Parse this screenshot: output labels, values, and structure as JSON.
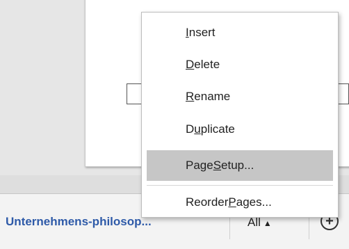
{
  "context_menu": {
    "items": [
      {
        "pre": "",
        "key": "I",
        "post": "nsert"
      },
      {
        "pre": "",
        "key": "D",
        "post": "elete"
      },
      {
        "pre": "",
        "key": "R",
        "post": "ename"
      },
      {
        "pre": "D",
        "key": "u",
        "post": "plicate"
      },
      {
        "pre": "Page ",
        "key": "S",
        "post": "etup..."
      },
      {
        "pre": "Reorder ",
        "key": "P",
        "post": "ages..."
      }
    ],
    "highlighted_index": 4
  },
  "tab_bar": {
    "page_tab_label": "Unternehmens-philosop...",
    "all_label": "All",
    "all_arrow": "▲",
    "add_symbol": "+"
  }
}
